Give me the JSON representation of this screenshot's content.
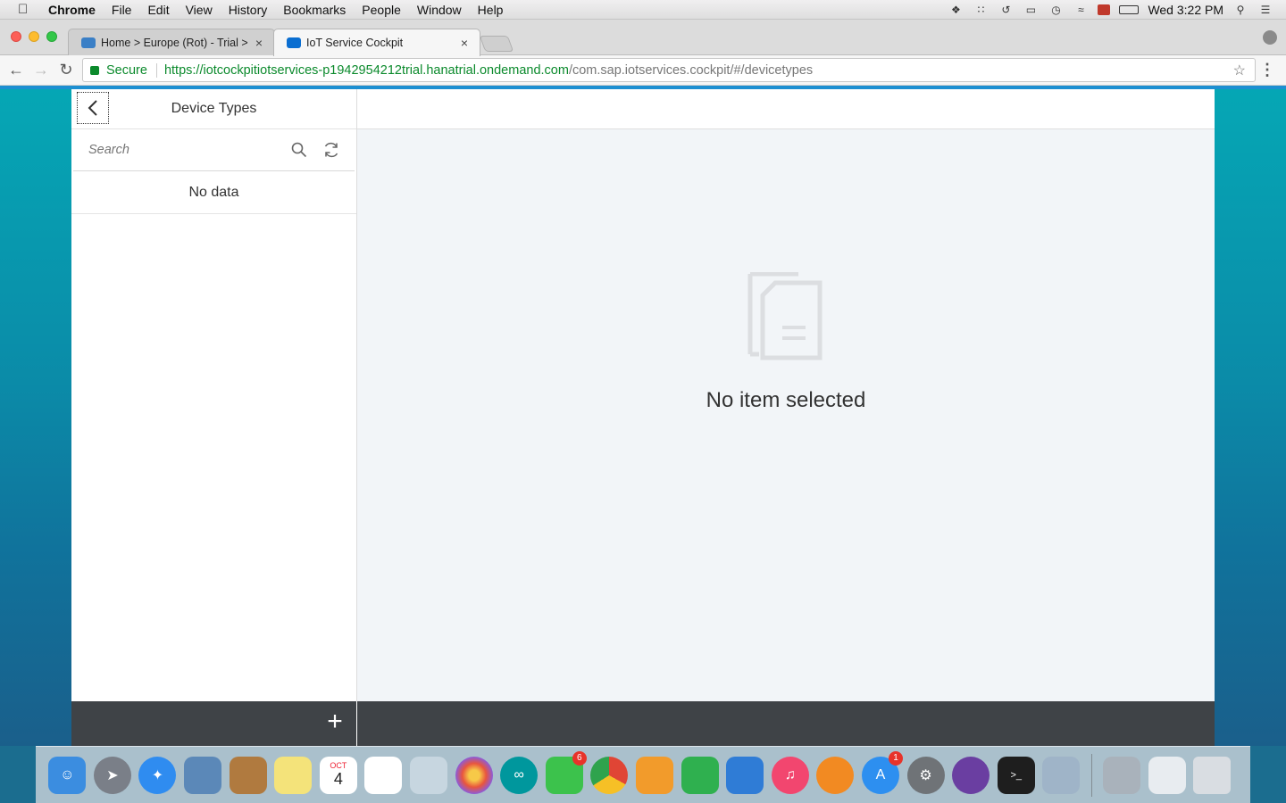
{
  "menubar": {
    "app": "Chrome",
    "items": [
      "File",
      "Edit",
      "View",
      "History",
      "Bookmarks",
      "People",
      "Window",
      "Help"
    ],
    "clock": "Wed 3:22 PM"
  },
  "tabs": [
    {
      "title": "Home > Europe (Rot) - Trial >",
      "favicon_color": "#3a7fc6"
    },
    {
      "title": "IoT Service Cockpit",
      "favicon_color": "#0a6ed1"
    }
  ],
  "omnibox": {
    "secure_label": "Secure",
    "url_scheme_host": "https://iotcockpitiotservices-p1942954212trial.hanatrial.ondemand.com",
    "url_path": "/com.sap.iotservices.cockpit/#/devicetypes"
  },
  "master": {
    "title": "Device Types",
    "search_placeholder": "Search",
    "no_data": "No data"
  },
  "detail": {
    "empty_text": "No item selected"
  },
  "footer": {
    "add_label": "+"
  },
  "dock": {
    "icons": [
      {
        "name": "finder-icon",
        "color": "#3b8de0"
      },
      {
        "name": "launchpad-icon",
        "color": "#7a7f88"
      },
      {
        "name": "safari-icon",
        "color": "#2f8cf0"
      },
      {
        "name": "preview-icon",
        "color": "#5b88b8"
      },
      {
        "name": "contacts-icon",
        "color": "#b07a3f"
      },
      {
        "name": "notes-icon",
        "color": "#f4e37a"
      },
      {
        "name": "calendar-icon",
        "color": "#ffffff"
      },
      {
        "name": "reminders-icon",
        "color": "#ffffff"
      },
      {
        "name": "photo-booth-icon",
        "color": "#c7d6e0"
      },
      {
        "name": "photos-icon",
        "color": "#f3f3f3"
      },
      {
        "name": "arduino-icon",
        "color": "#00979d"
      },
      {
        "name": "facetime-icon",
        "color": "#3cc24c"
      },
      {
        "name": "chrome-icon",
        "color": "#e04535"
      },
      {
        "name": "pages-icon",
        "color": "#f29b2b"
      },
      {
        "name": "numbers-icon",
        "color": "#2fb04f"
      },
      {
        "name": "keynote-icon",
        "color": "#2f7cd6"
      },
      {
        "name": "itunes-icon",
        "color": "#f2466f"
      },
      {
        "name": "ibooks-icon",
        "color": "#f28a22"
      },
      {
        "name": "app-store-icon",
        "color": "#2d8ff0"
      },
      {
        "name": "system-preferences-icon",
        "color": "#6f7377"
      },
      {
        "name": "github-icon",
        "color": "#6a3ea1"
      },
      {
        "name": "terminal-icon",
        "color": "#1e1e1e"
      },
      {
        "name": "image-capture-icon",
        "color": "#9fb4c8"
      }
    ],
    "badges": {
      "facetime": "6",
      "app_store": "1"
    },
    "calendar_month": "OCT",
    "calendar_day": "4"
  }
}
